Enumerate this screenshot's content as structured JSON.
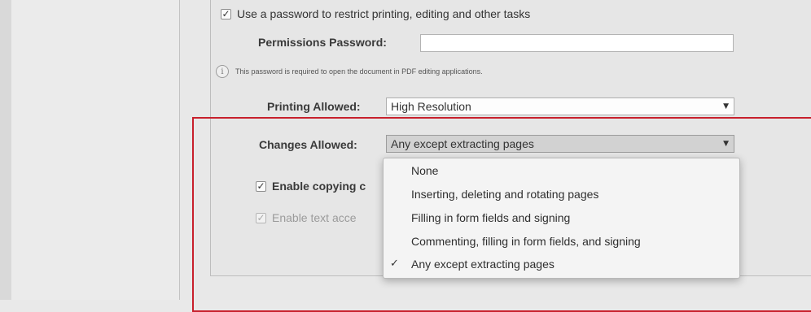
{
  "security": {
    "restrict_checkbox_label": "Use a password to restrict printing, editing and other tasks",
    "restrict_checked": true,
    "permissions_password_label": "Permissions Password:",
    "permissions_password_value": "",
    "info_note": "This password is required to open the document in PDF editing applications.",
    "printing_allowed_label": "Printing Allowed:",
    "printing_allowed_value": "High Resolution",
    "changes_allowed_label": "Changes Allowed:",
    "changes_allowed_value": "Any except extracting pages",
    "enable_copying_label": "Enable copying c",
    "enable_text_access_label": "Enable text acce",
    "check_glyph": "✓",
    "select_arrow": "▼"
  },
  "changes_dropdown": {
    "options": [
      "None",
      "Inserting, deleting and rotating pages",
      "Filling in form fields and signing",
      "Commenting, filling in form fields, and signing",
      "Any except extracting pages"
    ],
    "selected_index": 4,
    "selected_check": "✓"
  },
  "colors": {
    "annotation_outline": "#c8202c"
  }
}
